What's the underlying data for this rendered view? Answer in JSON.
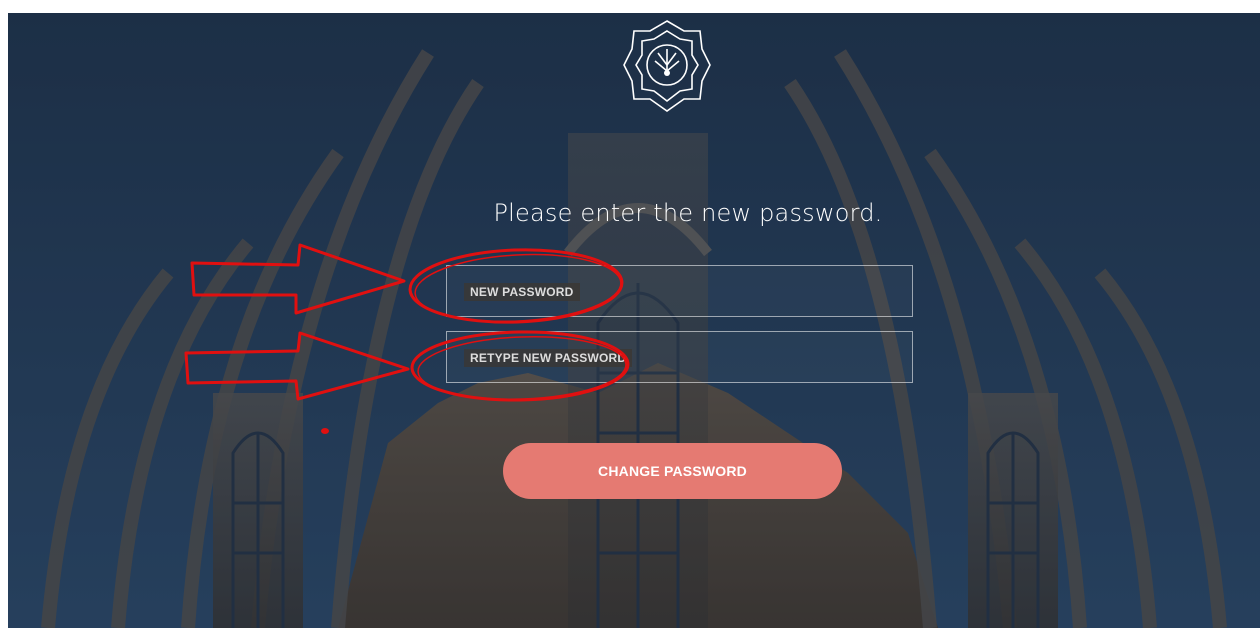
{
  "page": {
    "heading": "Please enter the new password."
  },
  "form": {
    "new_password": {
      "value": "",
      "placeholder": "NEW PASSWORD"
    },
    "retype_password": {
      "value": "",
      "placeholder": "RETYPE NEW PASSWORD"
    },
    "submit_label": "CHANGE PASSWORD"
  },
  "icons": {
    "logo": "university-emblem-icon"
  },
  "colors": {
    "button": "#e57a72",
    "sky": "#2c4a6e",
    "annotation": "#e01010",
    "text": "#ffffff"
  }
}
